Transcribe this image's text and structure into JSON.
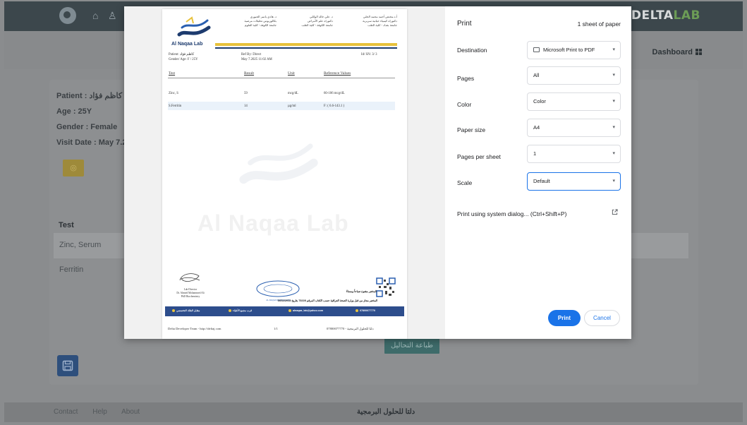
{
  "app": {
    "brand_main": "DELTA",
    "brand_accent": "LAB",
    "dashboard": "Dashboard",
    "patient_info": [
      "Patient : كاظم فؤاد",
      "Age : 25Y",
      "Gender : Female",
      "Visit Date : May 7.2"
    ],
    "table_header_test": "Test",
    "rows": [
      "Zinc, Serum",
      "Ferritin"
    ],
    "print_analysis_btn": "طباعة التحاليل",
    "footer_links": [
      "Contact",
      "Help",
      "About"
    ],
    "footer_arabic": "دلتا للحلول البرمجية"
  },
  "report": {
    "lab_name": "Al Naqaa Lab",
    "header_ar_left": [
      "أ.د.مختص أحمد محمد الحلي",
      "دكتوراه كيمياء حياتية سريرية",
      "جامعة بغداد - كلية الطب"
    ],
    "header_ar_mid": [
      "د. علي خالد الوائلي",
      "دكتوراه علم الأمراض",
      "جامعة الكوفة - كلية الطب"
    ],
    "header_ar_right": [
      "د. هادي ياسر الجبوري",
      "بكالوريوس تحليلات مرضية",
      "جامعة الكوفة - كلية العلوم"
    ],
    "meta": {
      "patient": "Patient: كاظم فؤاد",
      "gender_age": "Gender/ Age:  F / 25Y",
      "ref_by": "Ref By: Direct",
      "date": "May 7.2025 11:02 AM",
      "id": "Id/ SN: 3/ 3"
    },
    "columns": [
      "Test",
      "Result",
      "Unit",
      "Reference Values"
    ],
    "rows": [
      {
        "test": "Zinc, S",
        "result": "59",
        "unit": "mcg/dL",
        "ref": "60-106 mcg/dL"
      },
      {
        "test": "S.Ferritin",
        "result": "14",
        "unit": "µg/ml",
        "ref": "F: ( 6.6-143.1 )"
      }
    ],
    "watermark": "Al Naqaa Lab",
    "signature": [
      "Lab Director",
      "Dr. Ahmed Mohammed Ali",
      "PhD Biochemistry"
    ],
    "stamp_text": "AL-NAQAA MEDICAL LAB",
    "ar_note_1": "المختبر مفتوح صباحاً ومساءً",
    "ar_note_2": "المختبر مجاز من قبل وزارة الصحة العراقية حسب الكتاب المرقم 73228 بتاريخ 16/11/2013",
    "footer_items": [
      "مقابل الفلك التخصصي",
      "قرب مجمع الأطباء",
      "alnaqaa_lab@yahoo.com",
      "07800077770"
    ],
    "bottom_left": "Delta Developer Team - http://deltaj.com",
    "bottom_mid": "1/1",
    "bottom_right": "دلتا للحلول البرمجية - 07800077770"
  },
  "print": {
    "title": "Print",
    "sheets": "1 sheet of paper",
    "destination_label": "Destination",
    "destination_value": "Microsoft Print to PDF",
    "pages_label": "Pages",
    "pages_value": "All",
    "color_label": "Color",
    "color_value": "Color",
    "paper_label": "Paper size",
    "paper_value": "A4",
    "pps_label": "Pages per sheet",
    "pps_value": "1",
    "scale_label": "Scale",
    "scale_value": "Default",
    "system_dialog": "Print using system dialog... (Ctrl+Shift+P)",
    "print_btn": "Print",
    "cancel_btn": "Cancel"
  },
  "colors": {
    "accent_blue": "#1a73e8",
    "report_navy": "#1d3b6e",
    "report_gold": "#e8c23c",
    "brand_green": "#6c9c56"
  }
}
